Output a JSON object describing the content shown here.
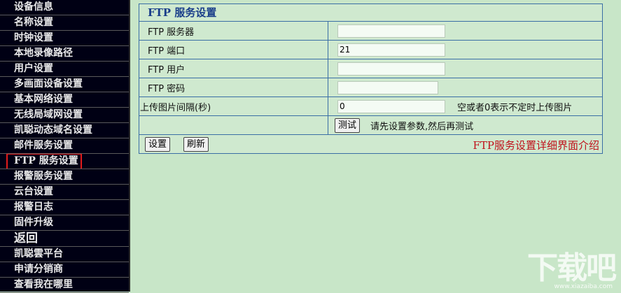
{
  "sidebar": {
    "items": [
      {
        "label": "设备信息"
      },
      {
        "label": "名称设置"
      },
      {
        "label": "时钟设置"
      },
      {
        "label": "本地录像路径"
      },
      {
        "label": "用户设置"
      },
      {
        "label": "多画面设备设置"
      },
      {
        "label": "基本网络设置"
      },
      {
        "label": "无线局域网设置"
      },
      {
        "label": "凯聪动态域名设置"
      },
      {
        "label": "邮件服务设置"
      },
      {
        "label": "FTP 服务设置"
      },
      {
        "label": "报警服务设置"
      },
      {
        "label": "云台设置"
      },
      {
        "label": "报警日志"
      },
      {
        "label": "固件升级"
      },
      {
        "label": "返回"
      },
      {
        "label": "凯聪雲平台"
      },
      {
        "label": "申请分销商"
      },
      {
        "label": "查看我在哪里"
      }
    ],
    "active_index": 10
  },
  "panel": {
    "title": "FTP 服务设置",
    "rows": {
      "server": {
        "label": "FTP 服务器",
        "value": ""
      },
      "port": {
        "label": "FTP 端口",
        "value": "21"
      },
      "user": {
        "label": "FTP 用户",
        "value": ""
      },
      "password": {
        "label": "FTP 密码",
        "value": ""
      },
      "interval": {
        "label": "上传图片间隔(秒)",
        "value": "0",
        "hint": "空或者0表示不定时上传图片"
      },
      "test": {
        "button": "测试",
        "hint": "请先设置参数,然后再测试"
      }
    },
    "footer": {
      "set_label": "设置",
      "refresh_label": "刷新",
      "caption": "FTP服务设置详细界面介绍"
    }
  },
  "watermark": {
    "text": "下载吧",
    "sub": "www.xiazaiba.com"
  },
  "colors": {
    "sidebar_bg": "#000014",
    "content_bg": "#c8e6c8",
    "border": "#3a6ea5",
    "highlight": "#e31b1b",
    "caption": "#c0101a"
  }
}
